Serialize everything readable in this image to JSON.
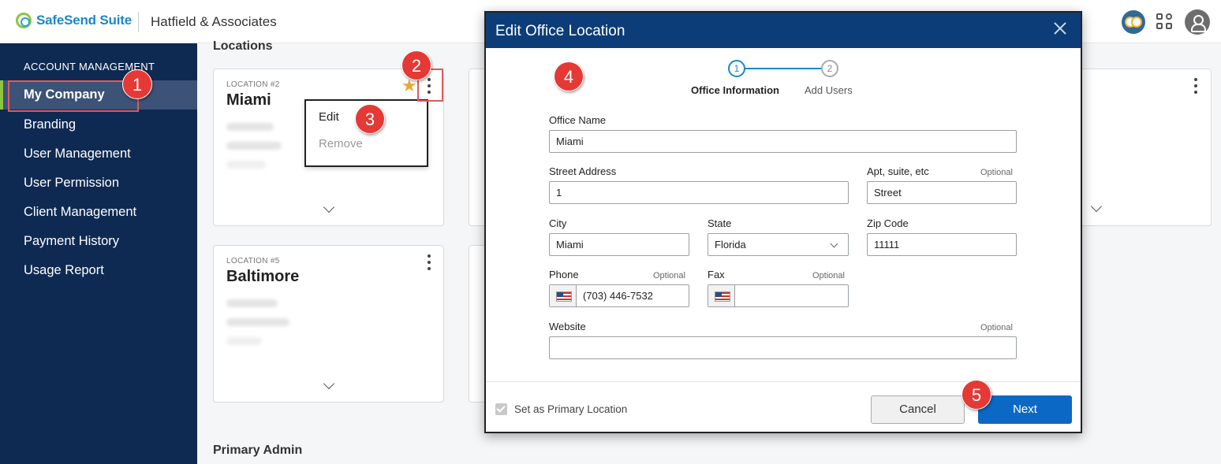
{
  "header": {
    "brand": "SafeSend Suite",
    "firm": "Hatfield & Associates",
    "icons": [
      "owl-avatar-icon",
      "apps-grid-icon",
      "user-profile-icon"
    ]
  },
  "sidebar": {
    "heading": "ACCOUNT MANAGEMENT",
    "items": [
      {
        "label": "My Company",
        "active": true
      },
      {
        "label": "Branding"
      },
      {
        "label": "User Management"
      },
      {
        "label": "User Permission"
      },
      {
        "label": "Client Management"
      },
      {
        "label": "Payment History"
      },
      {
        "label": "Usage Report"
      }
    ],
    "accent_color": "#8cc63f"
  },
  "main": {
    "section_title": "Locations",
    "cards": [
      {
        "number": "LOCATION #2",
        "name": "Miami",
        "primary": true
      },
      {
        "number": "LOCATION #5",
        "name": "Baltimore"
      }
    ],
    "context_menu": {
      "edit": "Edit",
      "remove": "Remove"
    },
    "bottom_section": "Primary Admin"
  },
  "annotations": [
    "1",
    "2",
    "3",
    "4",
    "5"
  ],
  "modal": {
    "title": "Edit Office Location",
    "steps": [
      {
        "num": "1",
        "label": "Office Information",
        "active": true
      },
      {
        "num": "2",
        "label": "Add Users"
      }
    ],
    "fields": {
      "office_name": {
        "label": "Office Name",
        "value": "Miami"
      },
      "street": {
        "label": "Street Address",
        "value": "1"
      },
      "apt": {
        "label": "Apt, suite, etc",
        "value": "Street",
        "optional": "Optional"
      },
      "city": {
        "label": "City",
        "value": "Miami"
      },
      "state": {
        "label": "State",
        "value": "Florida"
      },
      "zip": {
        "label": "Zip Code",
        "value": "11111"
      },
      "phone": {
        "label": "Phone",
        "value": "(703) 446-7532",
        "optional": "Optional"
      },
      "fax": {
        "label": "Fax",
        "value": "",
        "optional": "Optional"
      },
      "website": {
        "label": "Website",
        "value": "",
        "optional": "Optional"
      }
    },
    "primary_checkbox": "Set as Primary Location",
    "cancel": "Cancel",
    "next": "Next"
  },
  "colors": {
    "sidebar_bg": "#0f2a52",
    "modal_header": "#0d3d78",
    "next_button": "#0b68c5",
    "annotation": "#e53935"
  }
}
